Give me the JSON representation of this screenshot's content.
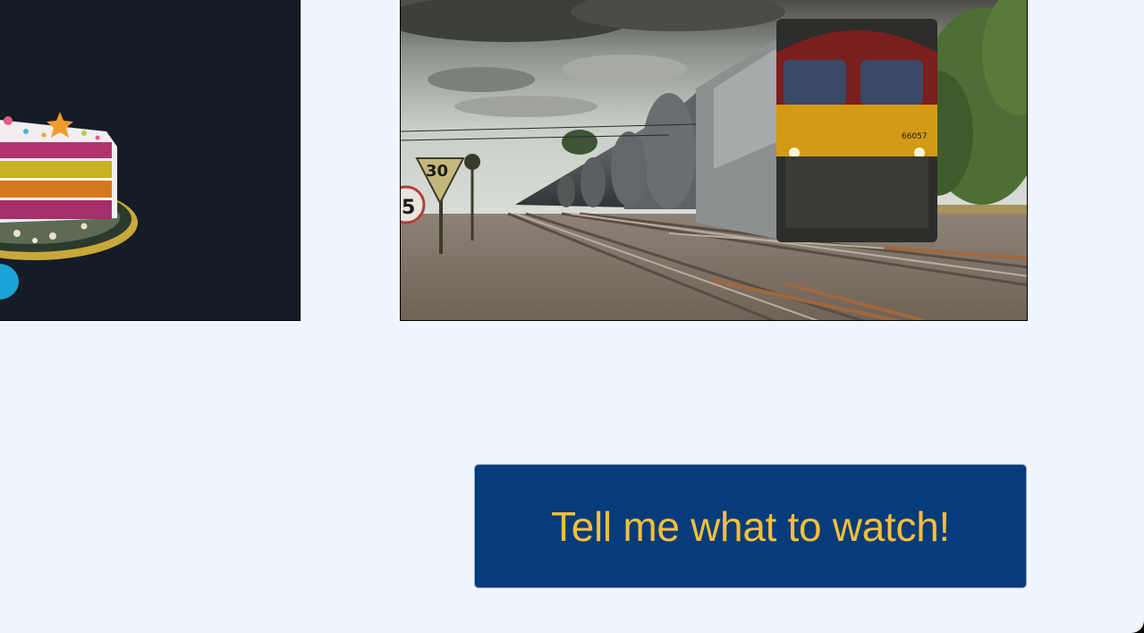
{
  "images": [
    {
      "name": "cake-image",
      "subject": "layered rainbow cake slice on a cake stand",
      "background_color": "#141d26"
    },
    {
      "name": "train-image",
      "subject": "freight locomotive pulling tank wagons on railway tracks",
      "locomotive_number": "66057",
      "sign_speed": "30",
      "sign_partial": "5"
    }
  ],
  "cta": {
    "label": "Tell me what to watch!",
    "background_color": "#063c7b",
    "text_color": "#f5bf3b"
  },
  "page": {
    "background_color": "#eff6ff"
  }
}
